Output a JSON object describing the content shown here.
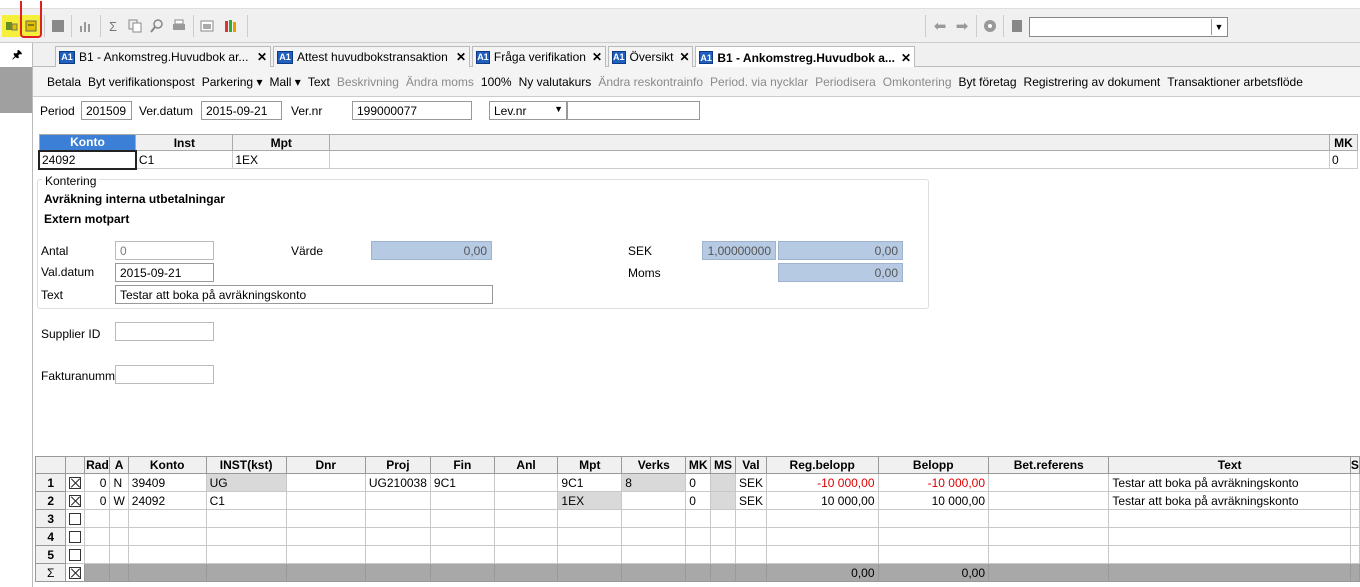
{
  "tabs": [
    {
      "icon": "A1",
      "label": "B1 - Ankomstreg.Huvudbok ar..."
    },
    {
      "icon": "A1",
      "label": "Attest huvudbokstransaktion"
    },
    {
      "icon": "A1",
      "label": "Fråga verifikation"
    },
    {
      "icon": "A1",
      "label": "Översikt"
    },
    {
      "icon": "A1",
      "label": "B1 - Ankomstreg.Huvudbok a..."
    }
  ],
  "menu": [
    {
      "label": "Betala",
      "enabled": true
    },
    {
      "label": "Byt verifikationspost",
      "enabled": true
    },
    {
      "label": "Parkering ▾",
      "enabled": true
    },
    {
      "label": "Mall ▾",
      "enabled": true
    },
    {
      "label": "Text",
      "enabled": true
    },
    {
      "label": "Beskrivning",
      "enabled": false
    },
    {
      "label": "Ändra moms",
      "enabled": false
    },
    {
      "label": "100%",
      "enabled": true
    },
    {
      "label": "Ny valutakurs",
      "enabled": true
    },
    {
      "label": "Ändra reskontrainfo",
      "enabled": false
    },
    {
      "label": "Period. via nycklar",
      "enabled": false
    },
    {
      "label": "Periodisera",
      "enabled": false
    },
    {
      "label": "Omkontering",
      "enabled": false
    },
    {
      "label": "Byt företag",
      "enabled": true
    },
    {
      "label": "Registrering av dokument",
      "enabled": true
    },
    {
      "label": "Transaktioner arbetsflöde",
      "enabled": true
    }
  ],
  "header": {
    "period_label": "Period",
    "period_value": "201509",
    "verdatum_label": "Ver.datum",
    "verdatum_value": "2015-09-21",
    "vernr_label": "Ver.nr",
    "vernr_value": "199000077",
    "levnr_select": "Lev.nr",
    "levnr_value": ""
  },
  "konto_table": {
    "headers": [
      "Konto",
      "Inst",
      "Mpt",
      "MK"
    ],
    "row": [
      "24092",
      "C1",
      "1EX",
      "0"
    ]
  },
  "kontering": {
    "legend": "Kontering",
    "desc1": "Avräkning interna utbetalningar",
    "desc2": "Extern motpart",
    "antal_label": "Antal",
    "antal_value": "0",
    "varde_label": "Värde",
    "varde_value": "0,00",
    "sek_label": "SEK",
    "sek_rate": "1,00000000",
    "sek_value": "0,00",
    "valdatum_label": "Val.datum",
    "valdatum_value": "2015-09-21",
    "moms_label": "Moms",
    "moms_value": "0,00",
    "text_label": "Text",
    "text_value": "Testar att boka på avräkningskonto"
  },
  "extra": {
    "supplier_label": "Supplier ID",
    "supplier_value": "",
    "faktura_label": "Fakturanummer",
    "faktura_value": ""
  },
  "grid": {
    "headers": [
      "",
      "",
      "Rad",
      "A",
      "Konto",
      "INST(kst)",
      "Dnr",
      "Proj",
      "Fin",
      "Anl",
      "Mpt",
      "Verks",
      "MK",
      "MS",
      "Val",
      "Reg.belopp",
      "Belopp",
      "Bet.referens",
      "Text",
      "S"
    ],
    "rows": [
      {
        "n": "1",
        "checked": true,
        "rad": "0",
        "a": "N",
        "konto": "39409",
        "inst": "UG",
        "dnr": "",
        "proj": "UG210038",
        "fin": "9C1",
        "anl": "",
        "mpt": "9C1",
        "verks": "8",
        "mk": "0",
        "ms": "",
        "val": "SEK",
        "reg": "-10 000,00",
        "belopp": "-10 000,00",
        "betref": "",
        "text": "Testar att boka på avräkningskonto"
      },
      {
        "n": "2",
        "checked": true,
        "rad": "0",
        "a": "W",
        "konto": "24092",
        "inst": "C1",
        "dnr": "",
        "proj": "",
        "fin": "",
        "anl": "",
        "mpt": "1EX",
        "verks": "",
        "mk": "0",
        "ms": "",
        "val": "SEK",
        "reg": "10 000,00",
        "belopp": "10 000,00",
        "betref": "",
        "text": "Testar att boka på avräkningskonto"
      },
      {
        "n": "3",
        "checked": false
      },
      {
        "n": "4",
        "checked": false
      },
      {
        "n": "5",
        "checked": false
      }
    ],
    "sum": {
      "n": "Σ",
      "reg": "0,00",
      "belopp": "0,00"
    }
  },
  "icons": [
    "new-entry-icon",
    "copy-entry-icon",
    "stop-icon",
    "chart-icon",
    "sigma-icon",
    "copy-icon",
    "find-icon",
    "print-icon",
    "window-icon",
    "books-icon",
    "back-arrow-icon",
    "forward-arrow-icon",
    "record-icon",
    "page-icon",
    "pin-icon"
  ],
  "colors": {
    "selected_header": "#3c7fd6",
    "readonly_field": "#b7cae3",
    "negative": "#e00000",
    "highlight_yellow": "#f5ef3a",
    "annotation_red": "#e02020",
    "tab_icon": "#1f5fbf"
  }
}
